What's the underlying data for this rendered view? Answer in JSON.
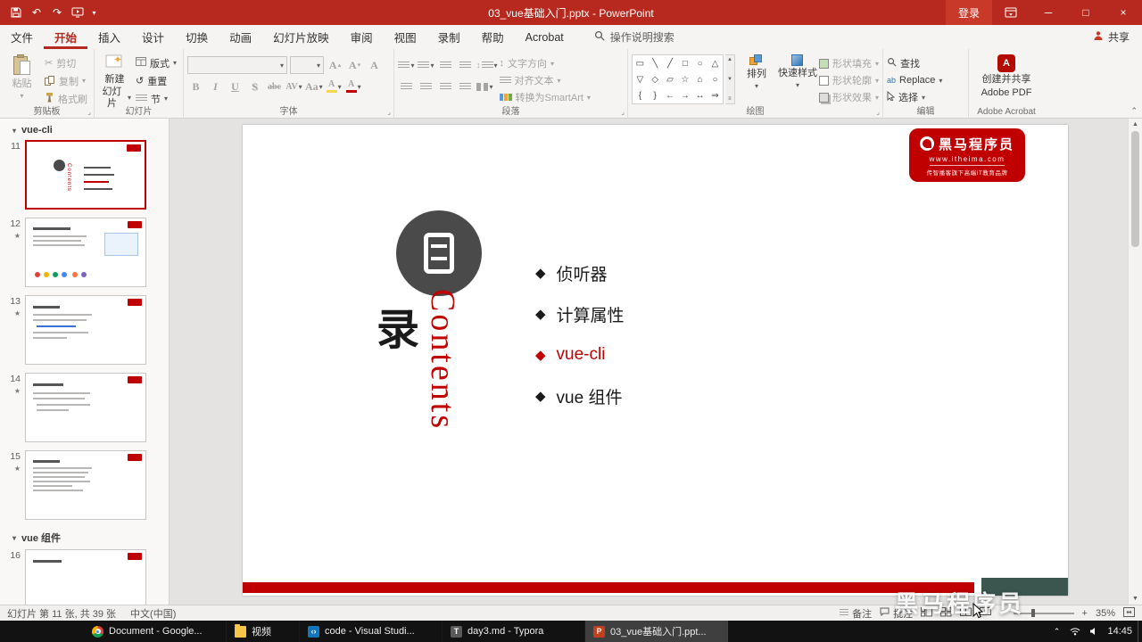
{
  "icons": {
    "caret": "▾",
    "caret_up": "⌃",
    "corner": "⌟",
    "star": "★",
    "undo": "↶",
    "redo": "↷",
    "minimize": "─",
    "maximize": "□",
    "close": "×",
    "cut": "✂",
    "scroll_up": "▲",
    "scroll_down": "▼",
    "zoom_in": "+",
    "zoom_out": "−",
    "updown": "↕",
    "reset_arrow": "↺"
  },
  "titlebar": {
    "title": "03_vue基础入门.pptx - PowerPoint",
    "signin_label": "登录"
  },
  "tabs": {
    "items": [
      "文件",
      "开始",
      "插入",
      "设计",
      "切换",
      "动画",
      "幻灯片放映",
      "审阅",
      "视图",
      "录制",
      "帮助",
      "Acrobat"
    ],
    "active": "开始",
    "tellme": "操作说明搜索",
    "share": "共享"
  },
  "ribbon": {
    "clipboard": {
      "label": "剪贴板",
      "paste": "粘贴",
      "cut": "剪切",
      "copy": "复制",
      "painter": "格式刷"
    },
    "slides": {
      "label": "幻灯片",
      "new1": "新建",
      "new2": "幻灯片",
      "layout": "版式",
      "reset": "重置",
      "section": "节"
    },
    "font": {
      "label": "字体",
      "bold": "B",
      "italic": "I",
      "underline": "U",
      "shadow": "S",
      "strike": "abc",
      "spacing": "AV",
      "case": "Aa",
      "grow": "A",
      "shrink": "A",
      "clear": "A",
      "highlight_color": "#f7d84b",
      "font_color": "#c00000"
    },
    "para": {
      "label": "段落",
      "dir": "文字方向",
      "align": "对齐文本",
      "smartart": "转换为SmartArt"
    },
    "draw": {
      "label": "绘图",
      "shapes": [
        "▭",
        "╲",
        "╱",
        "□",
        "○",
        "△",
        "▽",
        "◇",
        "▱",
        "☆",
        "⌂",
        "○",
        "{",
        "}",
        "←",
        "→",
        "↔",
        "⇒"
      ],
      "arrange": "排列",
      "quick": "快速样式",
      "fill": "形状填充",
      "outline": "形状轮廓",
      "effects": "形状效果"
    },
    "edit": {
      "label": "编辑",
      "find": "查找",
      "replace": "Replace",
      "select": "选择"
    },
    "acrobat": {
      "label": "Adobe Acrobat",
      "l1": "创建并共享",
      "l2": "Adobe PDF"
    }
  },
  "panel": {
    "section_vue_cli": "vue-cli",
    "section_vue_comp": "vue 组件",
    "slides": [
      {
        "num": "11"
      },
      {
        "num": "12"
      },
      {
        "num": "13"
      },
      {
        "num": "14"
      },
      {
        "num": "15"
      },
      {
        "num": "16"
      }
    ]
  },
  "slide": {
    "logo": {
      "brand": "黑马程序员",
      "site": "www.itheima.com",
      "tagline": "传智播客旗下高端IT教育品牌"
    },
    "toc_char": "录",
    "contents_word": "Contents",
    "items": [
      {
        "marker": "◆",
        "text": "侦听器",
        "color": "#1a1a1a"
      },
      {
        "marker": "◆",
        "text": "计算属性",
        "color": "#1a1a1a"
      },
      {
        "marker": "◆",
        "text": "vue-cli",
        "color": "#c00000"
      },
      {
        "marker": "◆",
        "text": "vue 组件",
        "color": "#1a1a1a"
      }
    ]
  },
  "status": {
    "slide_info": "幻灯片 第 11 张, 共 39 张",
    "language": "中文(中国)",
    "notes": "备注",
    "comments": "批注",
    "zoom": "35%"
  },
  "taskbar": {
    "items": [
      {
        "label": "Document - Google..."
      },
      {
        "label": "视频"
      },
      {
        "label": "code - Visual Studi..."
      },
      {
        "label": "day3.md - Typora"
      },
      {
        "label": "03_vue基础入门.ppt..."
      }
    ],
    "time": "14:45"
  },
  "watermark": "黑马程序员"
}
